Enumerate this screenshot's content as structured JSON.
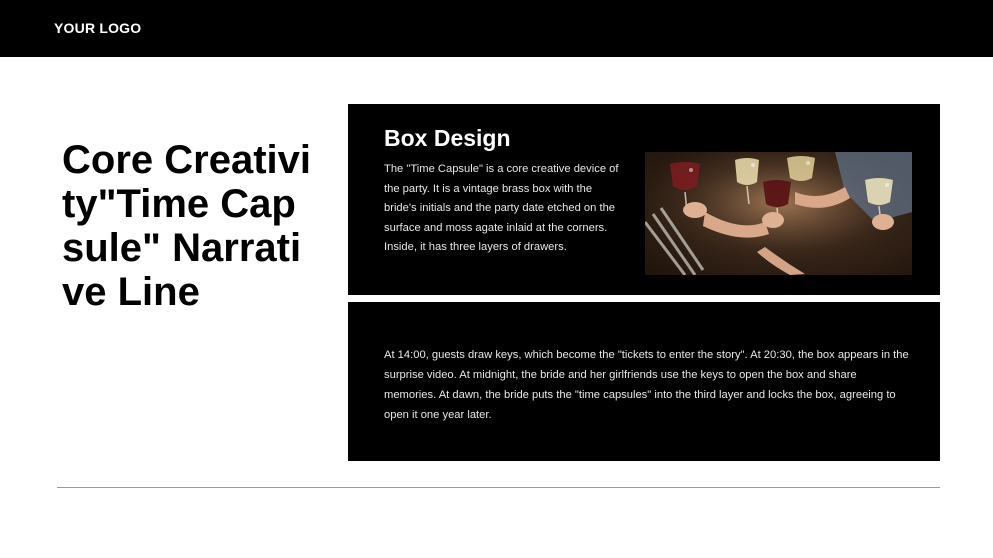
{
  "header": {
    "logo": "YOUR LOGO"
  },
  "title": "Core Creativity\"Time Capsule\" Narrative Line",
  "box_design": {
    "heading": "Box Design",
    "description": "The \"Time Capsule\" is a core creative device of the party. It is a vintage brass box with the bride's initials and the party date etched on the surface and moss agate inlaid at the corners. Inside, it has three layers of drawers."
  },
  "narrative": {
    "text": "At 14:00, guests draw keys, which become the \"tickets to enter the story\". At 20:30, the box appears in the surprise video. At midnight, the bride and her girlfriends use the keys to open the box and share memories. At dawn, the bride puts the \"time capsules\" into the third layer and locks the box, agreeing to open it one year later."
  },
  "colors": {
    "background": "#ffffff",
    "panel": "#000000",
    "text_light": "#e8e8e8"
  }
}
